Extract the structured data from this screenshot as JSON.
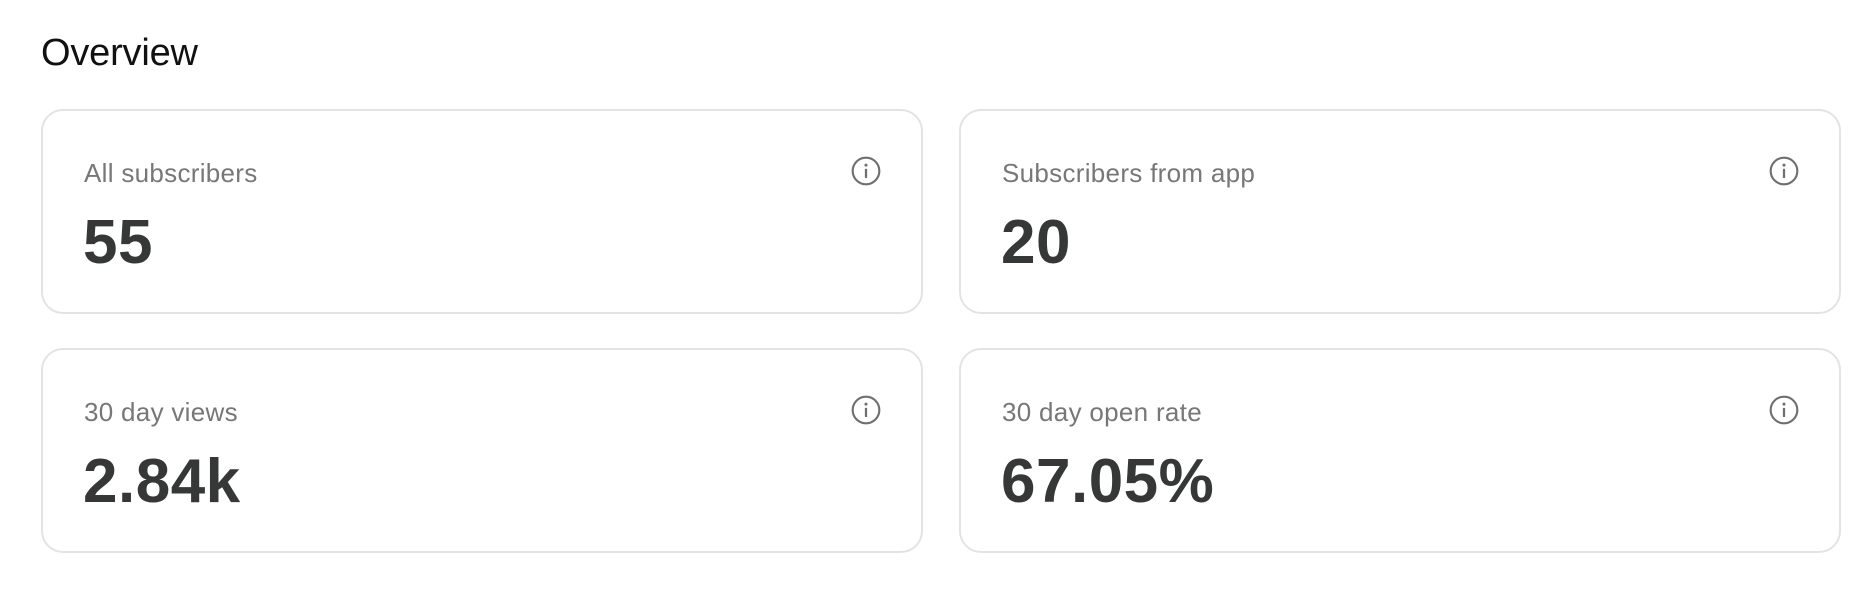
{
  "page": {
    "title": "Overview"
  },
  "cards": [
    {
      "label": "All subscribers",
      "value": "55",
      "icon": "info-icon"
    },
    {
      "label": "Subscribers from app",
      "value": "20",
      "icon": "info-icon"
    },
    {
      "label": "30 day views",
      "value": "2.84k",
      "icon": "info-icon"
    },
    {
      "label": "30 day open rate",
      "value": "67.05%",
      "icon": "info-icon"
    }
  ],
  "colors": {
    "value_text": "#363737",
    "label_text": "#777777",
    "card_border": "#e3e3e3",
    "icon": "#6f6f6f"
  }
}
